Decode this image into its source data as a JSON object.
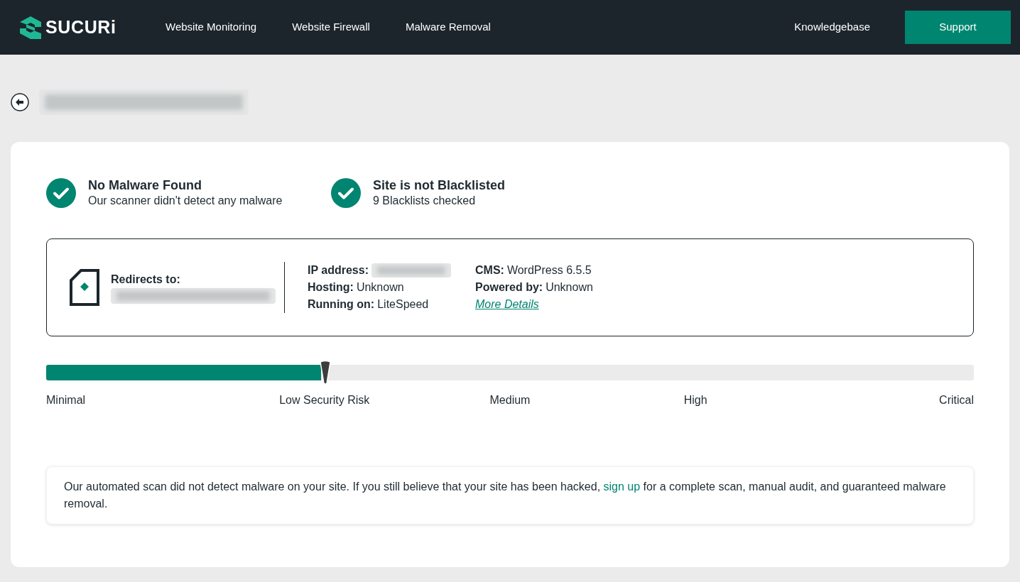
{
  "header": {
    "logo": "SUCURi",
    "nav": [
      "Website Monitoring",
      "Website Firewall",
      "Malware Removal"
    ],
    "right_link": "Knowledgebase",
    "button": "Support"
  },
  "status": [
    {
      "title": "No Malware Found",
      "subtitle": "Our scanner didn't detect any malware"
    },
    {
      "title": "Site is not Blacklisted",
      "subtitle": "9 Blacklists checked"
    }
  ],
  "site_info": {
    "redirects_label": "Redirects to:",
    "middle": [
      {
        "label": "IP address:"
      },
      {
        "label": "Hosting:",
        "value": "Unknown"
      },
      {
        "label": "Running on:",
        "value": "LiteSpeed"
      }
    ],
    "right": [
      {
        "label": "CMS:",
        "value": "WordPress 6.5.5"
      },
      {
        "label": "Powered by:",
        "value": "Unknown"
      }
    ],
    "link": "More Details"
  },
  "risk": {
    "level": 0.296,
    "labels": [
      "Minimal",
      "Low Security Risk",
      "Medium",
      "High",
      "Critical"
    ]
  },
  "notice": {
    "before": "Our automated scan did not detect malware on your site. If you still believe that your site has been hacked,",
    "link": "sign up",
    "after": "for a complete scan, manual audit, and guaranteed malware removal."
  }
}
